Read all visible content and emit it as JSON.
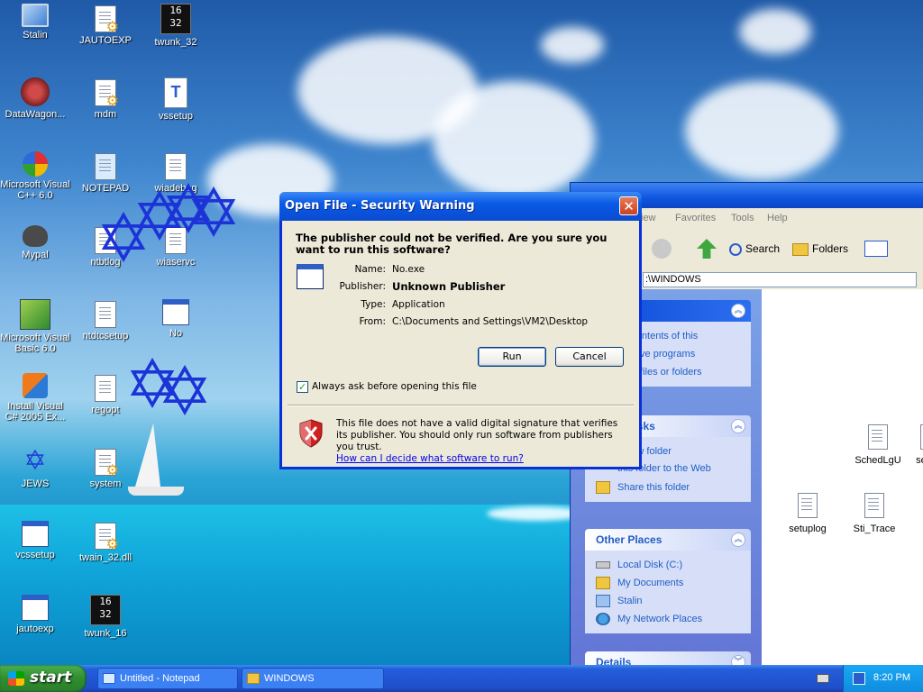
{
  "desktop": {
    "icons": [
      {
        "label": "Stalin",
        "icon": "my-computer-icon"
      },
      {
        "label": "JAUTOEXP",
        "icon": "config-file-icon"
      },
      {
        "label": "twunk_32",
        "icon": "16-32-app-icon"
      },
      {
        "label": "DataWagon...",
        "icon": "datawagon-shortcut-icon"
      },
      {
        "label": "mdm",
        "icon": "config-file-icon"
      },
      {
        "label": "vssetup",
        "icon": "text-document-icon"
      },
      {
        "label": "Microsoft Visual C++ 6.0",
        "icon": "visual-cpp-icon"
      },
      {
        "label": "NOTEPAD",
        "icon": "notepad-icon"
      },
      {
        "label": "wiadebug",
        "icon": "text-document-icon"
      },
      {
        "label": "Mypal",
        "icon": "mypal-browser-icon"
      },
      {
        "label": "ntbtlog",
        "icon": "text-document-icon"
      },
      {
        "label": "wiaservc",
        "icon": "text-document-icon"
      },
      {
        "label": "Microsoft Visual Basic 6.0",
        "icon": "visual-basic-icon"
      },
      {
        "label": "ntdtcsetup",
        "icon": "text-document-icon"
      },
      {
        "label": "No",
        "icon": "application-window-icon"
      },
      {
        "label": "Install Visual C# 2005 Ex...",
        "icon": "visual-csharp-icon"
      },
      {
        "label": "regopt",
        "icon": "text-document-icon"
      },
      {
        "label": "JEWS",
        "icon": "star-icon"
      },
      {
        "label": "system",
        "icon": "config-file-icon"
      },
      {
        "label": "vcssetup",
        "icon": "setup-icon"
      },
      {
        "label": "twain_32.dll",
        "icon": "dll-file-icon"
      },
      {
        "label": "jautoexp",
        "icon": "ini-file-icon"
      },
      {
        "label": "twunk_16",
        "icon": "16-32-app-icon"
      }
    ]
  },
  "explorer": {
    "menu": [
      "iew",
      "Favorites",
      "Tools",
      "Help"
    ],
    "toolbar": {
      "search": "Search",
      "folders": "Folders"
    },
    "address": ":\\WINDOWS",
    "panels": {
      "system_tasks": {
        "title": "asks",
        "links": [
          "he contents of this",
          "remove programs",
          "h for files or folders"
        ]
      },
      "folder_tasks": {
        "title": "older Tasks",
        "links": [
          "a new folder",
          "this folder to the Web",
          "Share this folder"
        ]
      },
      "other_places": {
        "title": "Other Places",
        "links": [
          "Local Disk (C:)",
          "My Documents",
          "Stalin",
          "My Network Places"
        ]
      },
      "details": {
        "title": "Details"
      }
    },
    "files": [
      "SchedLgU",
      "sessm",
      "setuplog",
      "Sti_Trace"
    ]
  },
  "dialog": {
    "title": "Open File - Security Warning",
    "question": "The publisher could not be verified.  Are you sure you want to run this software?",
    "fields": {
      "name_label": "Name:",
      "name_value": "No.exe",
      "publisher_label": "Publisher:",
      "publisher_value": "Unknown Publisher",
      "type_label": "Type:",
      "type_value": "Application",
      "from_label": "From:",
      "from_value": "C:\\Documents and Settings\\VM2\\Desktop"
    },
    "buttons": {
      "run": "Run",
      "cancel": "Cancel"
    },
    "checkbox_label": "Always ask before opening this file",
    "checkbox_checked": true,
    "warning_text": "This file does not have a valid digital signature that verifies its publisher.  You should only run software from publishers you trust.",
    "help_link": "How can I decide what software to run?"
  },
  "taskbar": {
    "start_label": "start",
    "tasks": [
      {
        "label": "Untitled - Notepad",
        "icon": "notepad-icon"
      },
      {
        "label": "WINDOWS",
        "icon": "folder-icon"
      }
    ],
    "clock": "8:20 PM"
  }
}
